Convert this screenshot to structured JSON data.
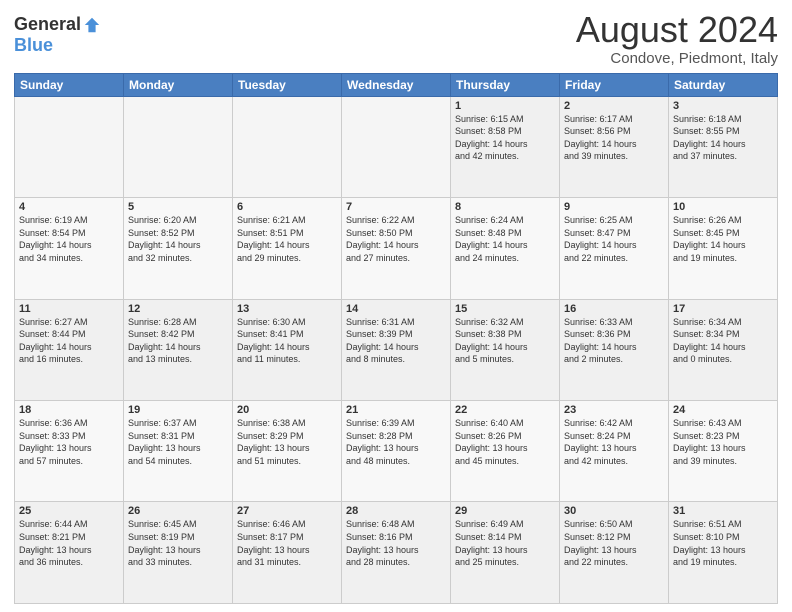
{
  "header": {
    "logo_general": "General",
    "logo_blue": "Blue",
    "title": "August 2024",
    "subtitle": "Condove, Piedmont, Italy"
  },
  "weekdays": [
    "Sunday",
    "Monday",
    "Tuesday",
    "Wednesday",
    "Thursday",
    "Friday",
    "Saturday"
  ],
  "weeks": [
    [
      {
        "day": "",
        "detail": ""
      },
      {
        "day": "",
        "detail": ""
      },
      {
        "day": "",
        "detail": ""
      },
      {
        "day": "",
        "detail": ""
      },
      {
        "day": "1",
        "detail": "Sunrise: 6:15 AM\nSunset: 8:58 PM\nDaylight: 14 hours\nand 42 minutes."
      },
      {
        "day": "2",
        "detail": "Sunrise: 6:17 AM\nSunset: 8:56 PM\nDaylight: 14 hours\nand 39 minutes."
      },
      {
        "day": "3",
        "detail": "Sunrise: 6:18 AM\nSunset: 8:55 PM\nDaylight: 14 hours\nand 37 minutes."
      }
    ],
    [
      {
        "day": "4",
        "detail": "Sunrise: 6:19 AM\nSunset: 8:54 PM\nDaylight: 14 hours\nand 34 minutes."
      },
      {
        "day": "5",
        "detail": "Sunrise: 6:20 AM\nSunset: 8:52 PM\nDaylight: 14 hours\nand 32 minutes."
      },
      {
        "day": "6",
        "detail": "Sunrise: 6:21 AM\nSunset: 8:51 PM\nDaylight: 14 hours\nand 29 minutes."
      },
      {
        "day": "7",
        "detail": "Sunrise: 6:22 AM\nSunset: 8:50 PM\nDaylight: 14 hours\nand 27 minutes."
      },
      {
        "day": "8",
        "detail": "Sunrise: 6:24 AM\nSunset: 8:48 PM\nDaylight: 14 hours\nand 24 minutes."
      },
      {
        "day": "9",
        "detail": "Sunrise: 6:25 AM\nSunset: 8:47 PM\nDaylight: 14 hours\nand 22 minutes."
      },
      {
        "day": "10",
        "detail": "Sunrise: 6:26 AM\nSunset: 8:45 PM\nDaylight: 14 hours\nand 19 minutes."
      }
    ],
    [
      {
        "day": "11",
        "detail": "Sunrise: 6:27 AM\nSunset: 8:44 PM\nDaylight: 14 hours\nand 16 minutes."
      },
      {
        "day": "12",
        "detail": "Sunrise: 6:28 AM\nSunset: 8:42 PM\nDaylight: 14 hours\nand 13 minutes."
      },
      {
        "day": "13",
        "detail": "Sunrise: 6:30 AM\nSunset: 8:41 PM\nDaylight: 14 hours\nand 11 minutes."
      },
      {
        "day": "14",
        "detail": "Sunrise: 6:31 AM\nSunset: 8:39 PM\nDaylight: 14 hours\nand 8 minutes."
      },
      {
        "day": "15",
        "detail": "Sunrise: 6:32 AM\nSunset: 8:38 PM\nDaylight: 14 hours\nand 5 minutes."
      },
      {
        "day": "16",
        "detail": "Sunrise: 6:33 AM\nSunset: 8:36 PM\nDaylight: 14 hours\nand 2 minutes."
      },
      {
        "day": "17",
        "detail": "Sunrise: 6:34 AM\nSunset: 8:34 PM\nDaylight: 14 hours\nand 0 minutes."
      }
    ],
    [
      {
        "day": "18",
        "detail": "Sunrise: 6:36 AM\nSunset: 8:33 PM\nDaylight: 13 hours\nand 57 minutes."
      },
      {
        "day": "19",
        "detail": "Sunrise: 6:37 AM\nSunset: 8:31 PM\nDaylight: 13 hours\nand 54 minutes."
      },
      {
        "day": "20",
        "detail": "Sunrise: 6:38 AM\nSunset: 8:29 PM\nDaylight: 13 hours\nand 51 minutes."
      },
      {
        "day": "21",
        "detail": "Sunrise: 6:39 AM\nSunset: 8:28 PM\nDaylight: 13 hours\nand 48 minutes."
      },
      {
        "day": "22",
        "detail": "Sunrise: 6:40 AM\nSunset: 8:26 PM\nDaylight: 13 hours\nand 45 minutes."
      },
      {
        "day": "23",
        "detail": "Sunrise: 6:42 AM\nSunset: 8:24 PM\nDaylight: 13 hours\nand 42 minutes."
      },
      {
        "day": "24",
        "detail": "Sunrise: 6:43 AM\nSunset: 8:23 PM\nDaylight: 13 hours\nand 39 minutes."
      }
    ],
    [
      {
        "day": "25",
        "detail": "Sunrise: 6:44 AM\nSunset: 8:21 PM\nDaylight: 13 hours\nand 36 minutes."
      },
      {
        "day": "26",
        "detail": "Sunrise: 6:45 AM\nSunset: 8:19 PM\nDaylight: 13 hours\nand 33 minutes."
      },
      {
        "day": "27",
        "detail": "Sunrise: 6:46 AM\nSunset: 8:17 PM\nDaylight: 13 hours\nand 31 minutes."
      },
      {
        "day": "28",
        "detail": "Sunrise: 6:48 AM\nSunset: 8:16 PM\nDaylight: 13 hours\nand 28 minutes."
      },
      {
        "day": "29",
        "detail": "Sunrise: 6:49 AM\nSunset: 8:14 PM\nDaylight: 13 hours\nand 25 minutes."
      },
      {
        "day": "30",
        "detail": "Sunrise: 6:50 AM\nSunset: 8:12 PM\nDaylight: 13 hours\nand 22 minutes."
      },
      {
        "day": "31",
        "detail": "Sunrise: 6:51 AM\nSunset: 8:10 PM\nDaylight: 13 hours\nand 19 minutes."
      }
    ]
  ]
}
